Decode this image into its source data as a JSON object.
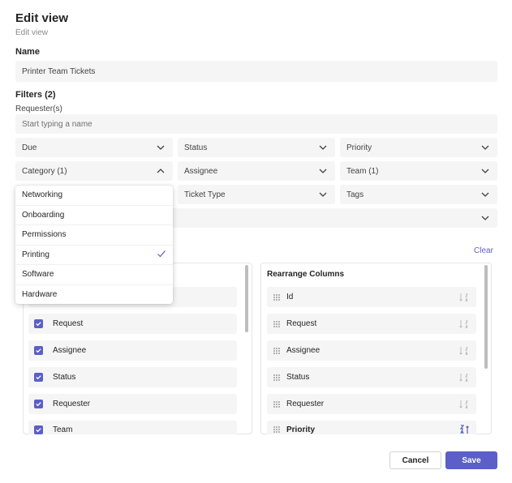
{
  "header": {
    "title": "Edit view",
    "subtitle": "Edit view"
  },
  "name_section": {
    "label": "Name",
    "value": "Printer Team Tickets"
  },
  "filters": {
    "label": "Filters (2)",
    "requester_label": "Requester(s)",
    "requester_placeholder": "Start typing a name",
    "dropdowns": {
      "due": "Due",
      "status": "Status",
      "priority": "Priority",
      "category": "Category (1)",
      "assignee": "Assignee",
      "team": "Team (1)",
      "ticket_type": "Ticket Type",
      "tags": "Tags"
    },
    "clear_label": "Clear"
  },
  "category_menu": {
    "items": [
      {
        "label": "Networking",
        "checked": false
      },
      {
        "label": "Onboarding",
        "checked": false
      },
      {
        "label": "Permissions",
        "checked": false
      },
      {
        "label": "Printing",
        "checked": true
      },
      {
        "label": "Software",
        "checked": false
      },
      {
        "label": "Hardware",
        "checked": false
      }
    ]
  },
  "select_columns": {
    "items": [
      "Request",
      "Assignee",
      "Status",
      "Requester",
      "Team"
    ]
  },
  "rearrange_columns": {
    "title": "Rearrange Columns",
    "items": [
      "Id",
      "Request",
      "Assignee",
      "Status",
      "Requester",
      "Priority"
    ]
  },
  "footer": {
    "cancel_label": "Cancel",
    "save_label": "Save"
  },
  "colors": {
    "accent": "#5b5fc7",
    "field_bg": "#f5f5f5"
  }
}
